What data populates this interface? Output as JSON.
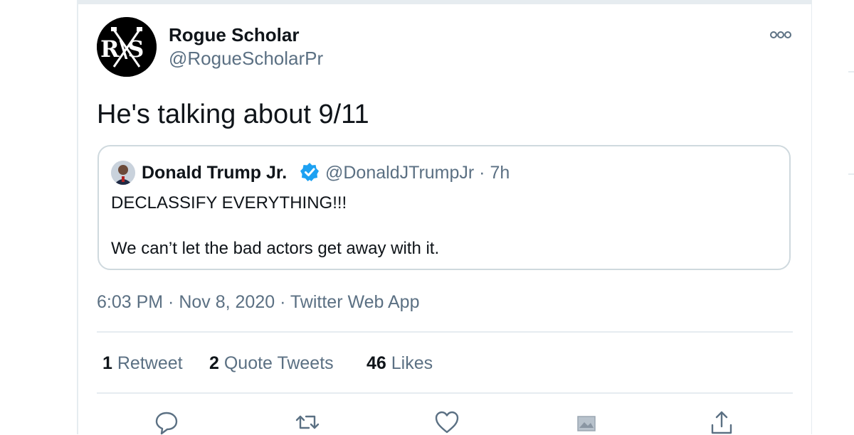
{
  "tweet": {
    "author": {
      "name": "Rogue Scholar",
      "handle": "@RogueScholarPr",
      "avatar_monogram": "R\\S",
      "avatar_icon": "crossed-swords-monogram"
    },
    "text": "He's talking about 9/11",
    "more_icon": "more-dots-icon",
    "quoted": {
      "name": "Donald Trump Jr.",
      "verified": true,
      "verified_icon": "verified-badge-icon",
      "meta": "@DonaldJTrumpJr · 7h",
      "lines": [
        "DECLASSIFY EVERYTHING!!!",
        "We can’t let the bad actors get away with it."
      ]
    },
    "timestamp": "6:03 PM · Nov 8, 2020 · Twitter Web App",
    "stats": {
      "retweets_count": "1",
      "retweets_label": "Retweet",
      "quotes_count": "2",
      "quotes_label": "Quote Tweets",
      "likes_count": "46",
      "likes_label": "Likes"
    },
    "actions": [
      "reply-icon",
      "retweet-icon",
      "like-icon",
      "bookmark-image-icon",
      "share-icon"
    ]
  },
  "colors": {
    "text": "#0f1419",
    "secondary": "#5b7083",
    "border": "#cfd9de",
    "verified": "#1da1f2"
  }
}
